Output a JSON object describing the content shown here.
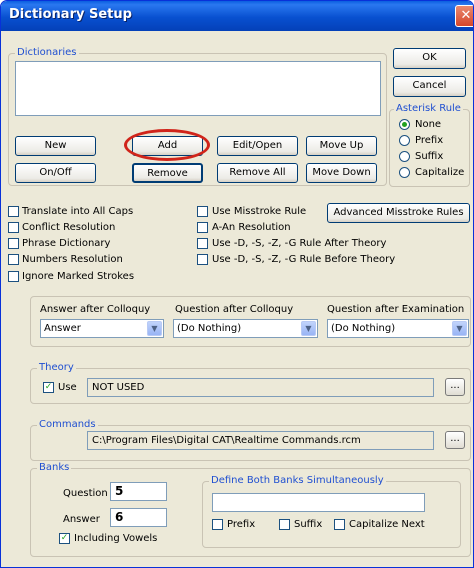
{
  "window": {
    "title": "Dictionary Setup",
    "close": "✕"
  },
  "dictionaries": {
    "group_label": "Dictionaries",
    "buttons": {
      "new": "New",
      "add": "Add",
      "edit_open": "Edit/Open",
      "move_up": "Move Up",
      "on_off": "On/Off",
      "remove": "Remove",
      "remove_all": "Remove All",
      "move_down": "Move Down"
    }
  },
  "dialog_buttons": {
    "ok": "OK",
    "cancel": "Cancel"
  },
  "asterisk_rule": {
    "label": "Asterisk Rule",
    "options": [
      "None",
      "Prefix",
      "Suffix",
      "Capitalize"
    ],
    "selected": "None"
  },
  "options_left": [
    "Translate into All Caps",
    "Conflict Resolution",
    "Phrase Dictionary",
    "Numbers Resolution",
    "Ignore Marked Strokes"
  ],
  "options_right": [
    "Use Misstroke Rule",
    "A-An Resolution",
    "Use -D, -S, -Z, -G Rule After Theory",
    "Use -D, -S, -Z, -G Rule Before Theory"
  ],
  "advanced_button": "Advanced Misstroke Rules",
  "colloquy": {
    "answer_label": "Answer after Colloquy",
    "answer_value": "Answer",
    "question_label": "Question after Colloquy",
    "question_value": "(Do Nothing)",
    "exam_label": "Question after Examination",
    "exam_value": "(Do Nothing)"
  },
  "theory": {
    "label": "Theory",
    "use_label": "Use",
    "value": "NOT USED",
    "browse": "..."
  },
  "commands": {
    "label": "Commands",
    "path": "C:\\Program Files\\Digital CAT\\Realtime Commands.rcm",
    "browse": "..."
  },
  "banks": {
    "label": "Banks",
    "question_label": "Question",
    "question_value": "5",
    "answer_label": "Answer",
    "answer_value": "6",
    "vowels_label": "Including Vowels",
    "define_label": "Define Both Banks Simultaneously",
    "define_value": "",
    "prefix": "Prefix",
    "suffix": "Suffix",
    "capitalize_next": "Capitalize Next"
  },
  "annotation_color": "#d0241a"
}
